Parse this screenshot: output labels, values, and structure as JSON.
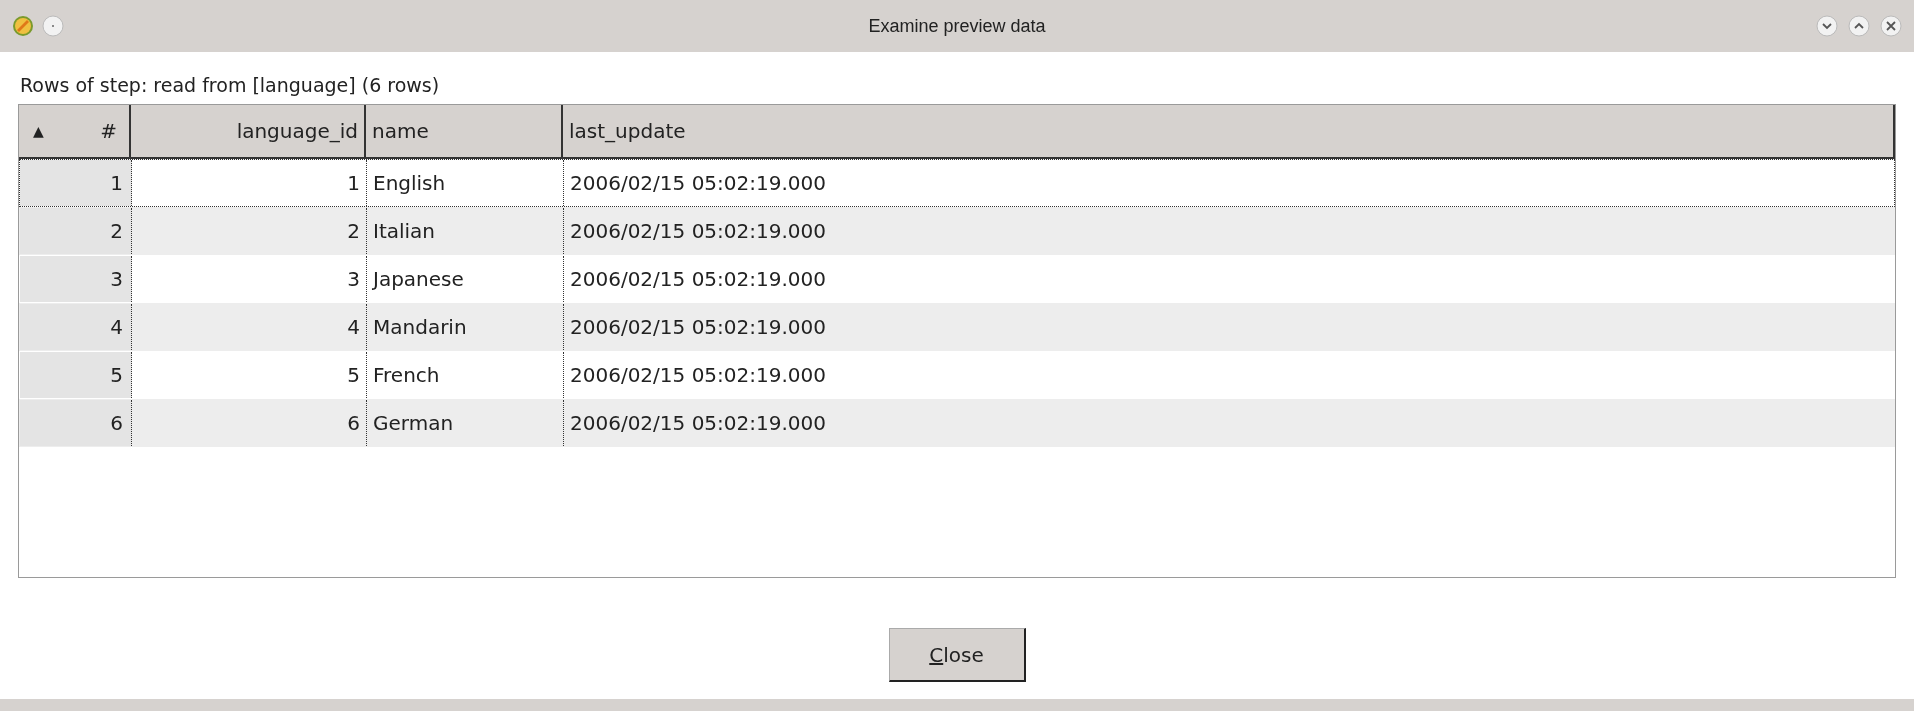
{
  "window": {
    "title": "Examine preview data"
  },
  "caption": "Rows of step: read from [language] (6 rows)",
  "table": {
    "sort_indicator": "▲",
    "columns": [
      "#",
      "language_id",
      "name",
      "last_update"
    ],
    "rows": [
      {
        "cells": [
          "1",
          "1",
          "English",
          "2006/02/15 05:02:19.000"
        ],
        "selected": true
      },
      {
        "cells": [
          "2",
          "2",
          "Italian",
          "2006/02/15 05:02:19.000"
        ],
        "selected": false
      },
      {
        "cells": [
          "3",
          "3",
          "Japanese",
          "2006/02/15 05:02:19.000"
        ],
        "selected": false
      },
      {
        "cells": [
          "4",
          "4",
          "Mandarin",
          "2006/02/15 05:02:19.000"
        ],
        "selected": false
      },
      {
        "cells": [
          "5",
          "5",
          "French",
          "2006/02/15 05:02:19.000"
        ],
        "selected": false
      },
      {
        "cells": [
          "6",
          "6",
          "German",
          "2006/02/15 05:02:19.000"
        ],
        "selected": false
      }
    ]
  },
  "close_button": {
    "mnemonic": "C",
    "rest": "lose"
  }
}
